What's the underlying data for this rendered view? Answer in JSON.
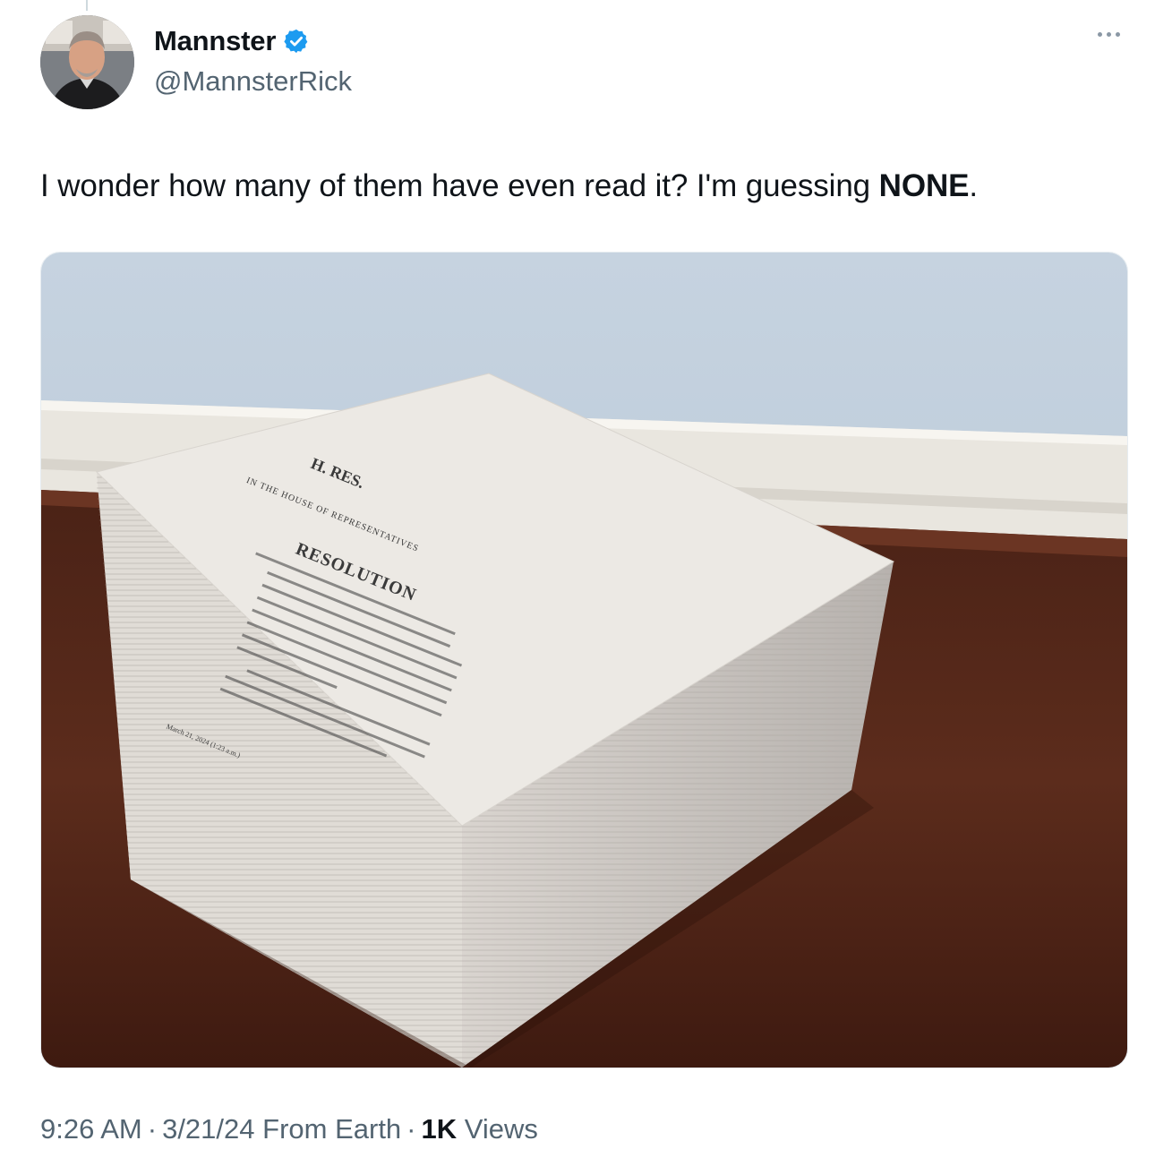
{
  "author": {
    "display_name": "Mannster",
    "handle": "@MannsterRick",
    "verified": true,
    "verified_color": "#1d9bf0"
  },
  "tweet": {
    "text_before": "I wonder how many of them have even read it?  I'm guessing ",
    "text_bold": "NONE",
    "text_after": "."
  },
  "media": {
    "doc_header": "H. RES.",
    "doc_chamber": "IN THE HOUSE OF REPRESENTATIVES",
    "doc_title": "RESOLUTION",
    "doc_date": "March 21, 2024 (1:23 a.m.)"
  },
  "meta": {
    "time": "9:26 AM",
    "date": "3/21/24",
    "source": "From Earth",
    "views_count": "1K",
    "views_label": "Views"
  },
  "icons": {
    "more": "more-horizontal-icon",
    "verified": "verified-badge-icon"
  }
}
